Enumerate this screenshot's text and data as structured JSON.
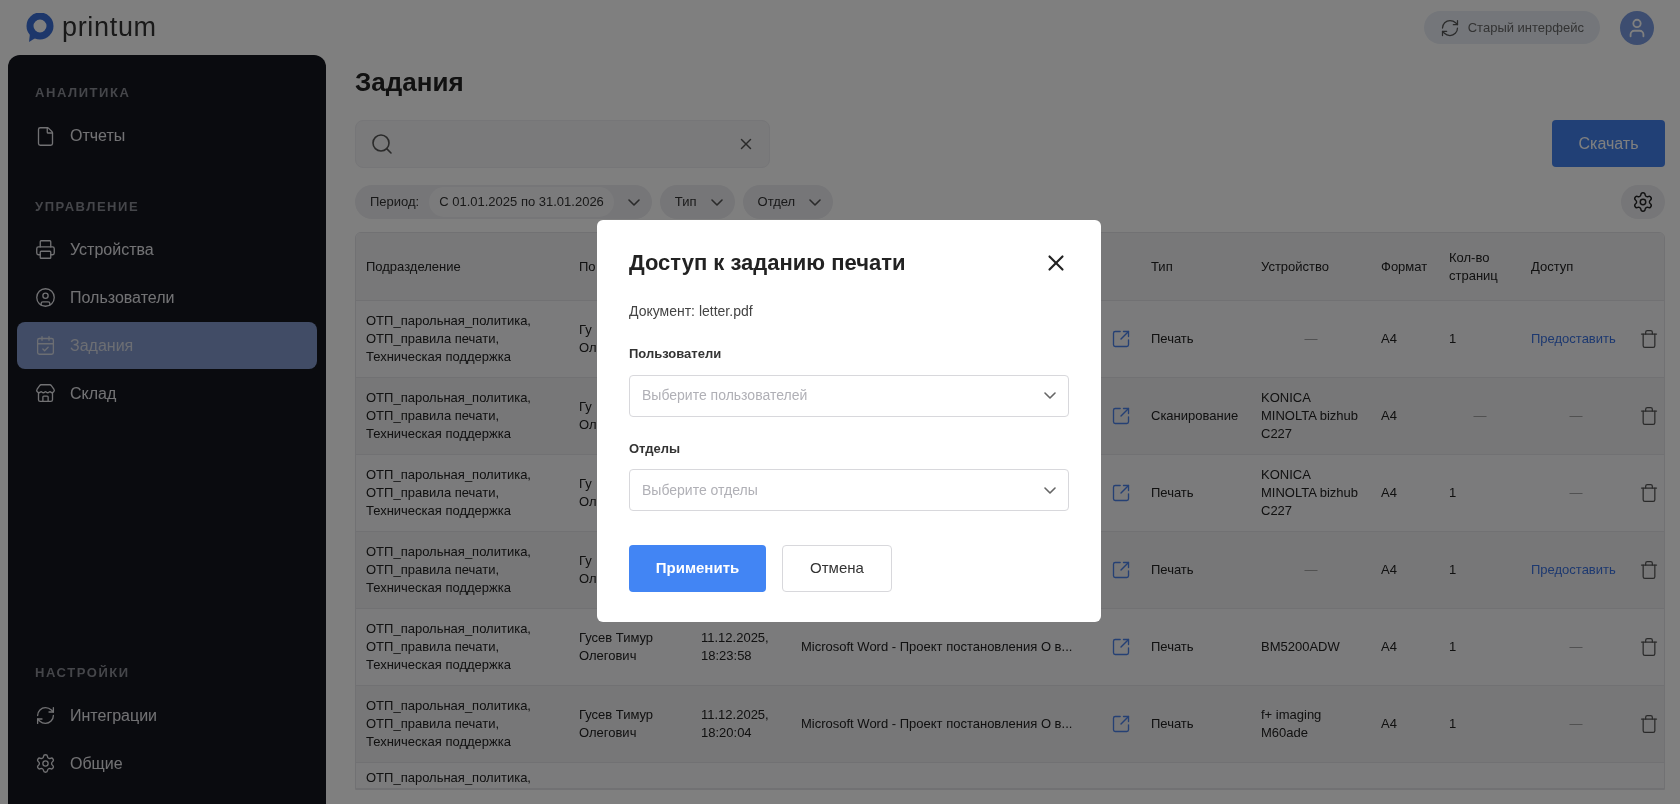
{
  "header": {
    "logo_text": "printum",
    "old_ui_button": "Старый интерфейс"
  },
  "sidebar": {
    "sections": [
      {
        "title": "АНАЛИТИКА",
        "items": [
          {
            "label": "Отчеты",
            "selected": false
          }
        ]
      },
      {
        "title": "УПРАВЛЕНИЕ",
        "items": [
          {
            "label": "Устройства",
            "selected": false
          },
          {
            "label": "Пользователи",
            "selected": false
          },
          {
            "label": "Задания",
            "selected": true
          },
          {
            "label": "Склад",
            "selected": false
          }
        ]
      },
      {
        "title": "НАСТРОЙКИ",
        "items": [
          {
            "label": "Интеграции",
            "selected": false
          },
          {
            "label": "Общие",
            "selected": false
          }
        ]
      }
    ]
  },
  "page": {
    "title": "Задания",
    "download_button": "Скачать",
    "filters": [
      {
        "label": "Период:",
        "value": "С 01.01.2025 по 31.01.2026"
      },
      {
        "label": "Тип"
      },
      {
        "label": "Отдел"
      }
    ]
  },
  "table": {
    "columns": {
      "department": "Подразделение",
      "user": "По",
      "type": "Тип",
      "device": "Устройство",
      "format": "Формат",
      "pages": "Кол-во страниц",
      "access": "Доступ"
    },
    "rows": [
      {
        "department": [
          "ОТП_парольная_политика,",
          "ОТП_правила печати,",
          "Техническая поддержка"
        ],
        "user": [
          "Гу",
          "Ол"
        ],
        "type": "Печать",
        "device": {
          "kind": "dash",
          "lines": [
            "—"
          ]
        },
        "format": "A4",
        "pages": {
          "kind": "text",
          "text": "1"
        },
        "access": {
          "kind": "link",
          "text": "Предоставить"
        }
      },
      {
        "department": [
          "ОТП_парольная_политика,",
          "ОТП_правила печати,",
          "Техническая поддержка"
        ],
        "user": [
          "Гу",
          "Ол"
        ],
        "type": "Сканирование",
        "device": {
          "kind": "text",
          "lines": [
            "KONICA",
            "MINOLTA bizhub",
            "C227"
          ]
        },
        "format": "A4",
        "pages": {
          "kind": "dash",
          "text": "—"
        },
        "access": {
          "kind": "dash",
          "text": "—"
        }
      },
      {
        "department": [
          "ОТП_парольная_политика,",
          "ОТП_правила печати,",
          "Техническая поддержка"
        ],
        "user": [
          "Гу",
          "Ол"
        ],
        "type": "Печать",
        "device": {
          "kind": "text",
          "lines": [
            "KONICA",
            "MINOLTA bizhub",
            "C227"
          ]
        },
        "format": "A4",
        "pages": {
          "kind": "text",
          "text": "1"
        },
        "access": {
          "kind": "dash",
          "text": "—"
        }
      },
      {
        "department": [
          "ОТП_парольная_политика,",
          "ОТП_правила печати,",
          "Техническая поддержка"
        ],
        "user": [
          "Гу",
          "Ол"
        ],
        "type": "Печать",
        "device": {
          "kind": "dash",
          "lines": [
            "—"
          ]
        },
        "format": "A4",
        "pages": {
          "kind": "text",
          "text": "1"
        },
        "access": {
          "kind": "link",
          "text": "Предоставить"
        }
      },
      {
        "department": [
          "ОТП_парольная_политика,",
          "ОТП_правила печати,",
          "Техническая поддержка"
        ],
        "user": [
          "Гусев Тимур",
          "Олегович"
        ],
        "date": [
          "11.12.2025,",
          "18:23:58"
        ],
        "document": "Microsoft Word - Проект постановления О в...",
        "type": "Печать",
        "device": {
          "kind": "text",
          "lines": [
            "BM5200ADW"
          ]
        },
        "format": "A4",
        "pages": {
          "kind": "text",
          "text": "1"
        },
        "access": {
          "kind": "dash",
          "text": "—"
        }
      },
      {
        "department": [
          "ОТП_парольная_политика,",
          "ОТП_правила печати,",
          "Техническая поддержка"
        ],
        "user": [
          "Гусев Тимур",
          "Олегович"
        ],
        "date": [
          "11.12.2025,",
          "18:20:04"
        ],
        "document": "Microsoft Word - Проект постановления О в...",
        "type": "Печать",
        "device": {
          "kind": "text",
          "lines": [
            "f+ imaging",
            "M60ade"
          ]
        },
        "format": "A4",
        "pages": {
          "kind": "text",
          "text": "1"
        },
        "access": {
          "kind": "dash",
          "text": "—"
        }
      },
      {
        "department": [
          "ОТП_парольная_политика,"
        ]
      }
    ]
  },
  "dialog": {
    "title": "Доступ к заданию печати",
    "document_line": "Документ: letter.pdf",
    "fields": [
      {
        "label": "Пользователи",
        "placeholder": "Выберите пользователей"
      },
      {
        "label": "Отделы",
        "placeholder": "Выберите отделы"
      }
    ],
    "apply_button": "Применить",
    "cancel_button": "Отмена"
  }
}
